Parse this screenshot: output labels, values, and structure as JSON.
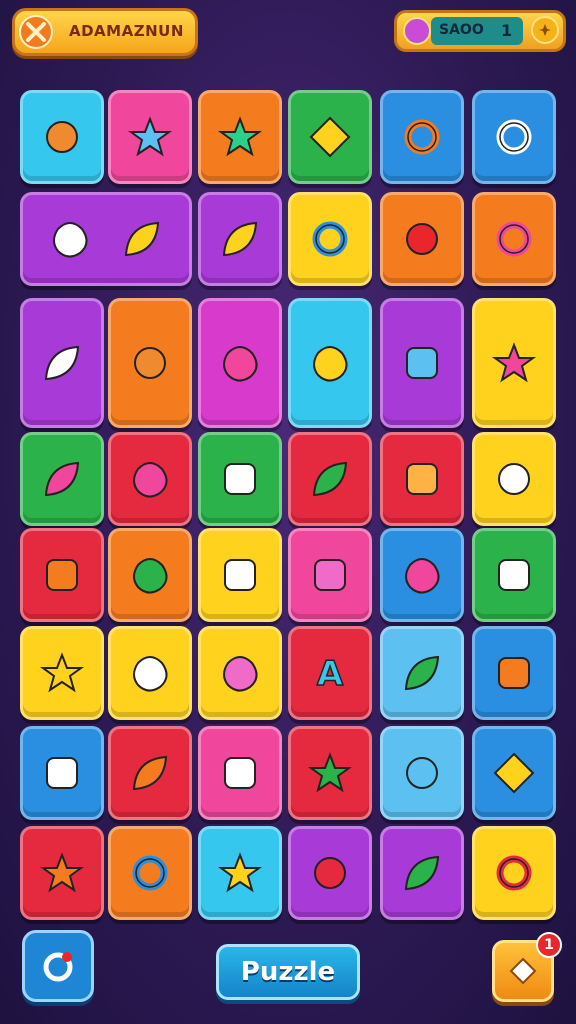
{
  "header": {
    "brand_label": "ADAMAZNUN",
    "score_label": "SAOO",
    "score_value": "1"
  },
  "footer": {
    "puzzle_label": "Puzzle",
    "hint_badge": "1"
  },
  "colors": {
    "cyan": "#36c7ef",
    "pink": "#f0479c",
    "orange": "#f57c1e",
    "green": "#2bb24a",
    "blue": "#2a8fe0",
    "purple": "#a83ad8",
    "yellow": "#ffd21e",
    "red": "#e52a3f",
    "magenta": "#d83acb",
    "lightblue": "#5cc0f0"
  },
  "tiles": [
    {
      "icon": "fox-face-icon",
      "color": "cyan"
    },
    {
      "icon": "star-icon",
      "color": "pink"
    },
    {
      "icon": "gear-star-icon",
      "color": "orange"
    },
    {
      "icon": "shuriken-icon",
      "color": "green"
    },
    {
      "icon": "diamond-ring-icon",
      "color": "blue"
    },
    {
      "icon": "swirl-icon",
      "color": "blue"
    },
    {
      "icon": "network-nodes-icon",
      "color": "purple"
    },
    {
      "icon": "bag-icon",
      "color": "purple"
    },
    {
      "icon": "donut-icon",
      "color": "yellow"
    },
    {
      "icon": "bomb-icon",
      "color": "orange"
    },
    {
      "icon": "ring-bolts-icon",
      "color": "orange"
    },
    {
      "icon": "feather-pen-icon",
      "color": "purple"
    },
    {
      "icon": "fox-character-icon",
      "color": "orange"
    },
    {
      "icon": "paint-splat-icon",
      "color": "magenta"
    },
    {
      "icon": "smile-cup-icon",
      "color": "cyan"
    },
    {
      "icon": "bar-chart-icon",
      "color": "purple"
    },
    {
      "icon": "compass-star-icon",
      "color": "yellow"
    },
    {
      "icon": "pencil-icon",
      "color": "green"
    },
    {
      "icon": "pink-monster-icon",
      "color": "red"
    },
    {
      "icon": "note-paper-icon",
      "color": "green"
    },
    {
      "icon": "leaf-icon",
      "color": "red"
    },
    {
      "icon": "square-face-icon",
      "color": "red"
    },
    {
      "icon": "white-cat-icon",
      "color": "yellow"
    },
    {
      "icon": "letter-a-badge-icon",
      "color": "red"
    },
    {
      "icon": "chat-bubble-icon",
      "color": "orange"
    },
    {
      "icon": "pen-note-icon",
      "color": "yellow"
    },
    {
      "icon": "arch-icon",
      "color": "pink"
    },
    {
      "icon": "fruit-icon",
      "color": "blue"
    },
    {
      "icon": "message-face-icon",
      "color": "green"
    },
    {
      "icon": "sun-flower-icon",
      "color": "yellow"
    },
    {
      "icon": "ghost-bubble-icon",
      "color": "yellow"
    },
    {
      "icon": "jelly-bean-icon",
      "color": "yellow"
    },
    {
      "icon": "letter-a-icon",
      "color": "red"
    },
    {
      "icon": "green-bubble-icon",
      "color": "lightblue"
    },
    {
      "icon": "orange-face-icon",
      "color": "blue"
    },
    {
      "icon": "calculator-icon",
      "color": "blue"
    },
    {
      "icon": "brush-icon",
      "color": "red"
    },
    {
      "icon": "usb-stick-icon",
      "color": "pink"
    },
    {
      "icon": "green-star-icon",
      "color": "red"
    },
    {
      "icon": "bear-face-icon",
      "color": "lightblue"
    },
    {
      "icon": "shield-icon",
      "color": "blue"
    },
    {
      "icon": "sun-badge-icon",
      "color": "red"
    },
    {
      "icon": "blue-ring-icon",
      "color": "orange"
    },
    {
      "icon": "yellow-burst-icon",
      "color": "cyan"
    },
    {
      "icon": "red-berry-icon",
      "color": "purple"
    },
    {
      "icon": "carrot-icon",
      "color": "purple"
    },
    {
      "icon": "red-ring-icon",
      "color": "yellow"
    },
    {
      "icon": "music-note-icon",
      "color": "orange"
    }
  ]
}
